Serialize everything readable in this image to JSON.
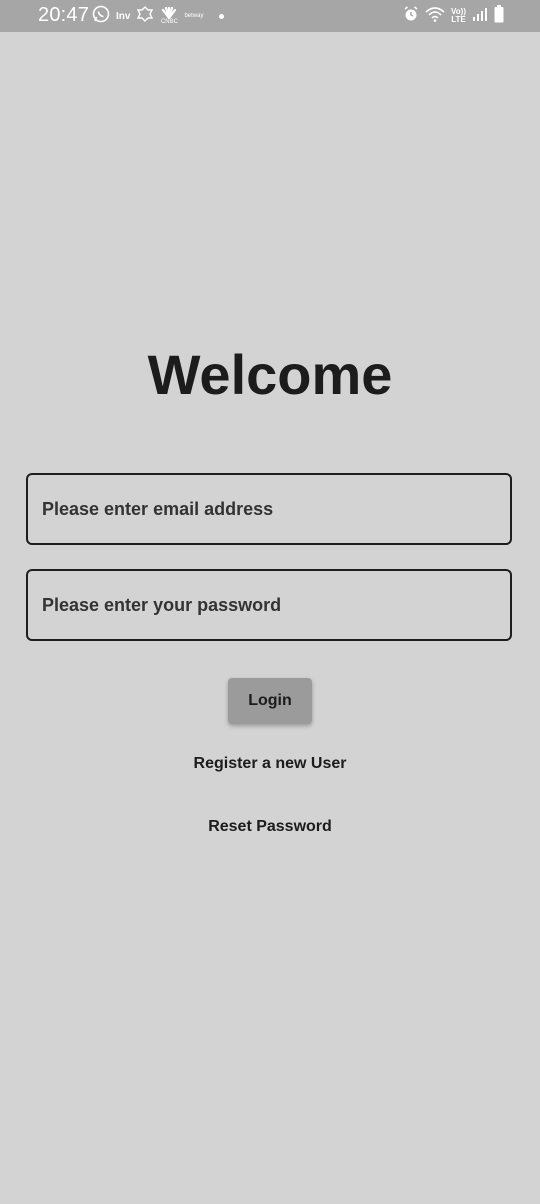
{
  "status_bar": {
    "time": "20:47",
    "left_icons": [
      "whatsapp-icon",
      "inv-app-icon",
      "notification-app-icon",
      "cnbc-icon",
      "betway-icon"
    ],
    "inv_text": "Inv",
    "cnbc_text": "CNBC",
    "betway_text": "betway",
    "volte_line1": "Vo))",
    "volte_line2": "LTE",
    "right_icons": [
      "alarm-icon",
      "wifi-icon",
      "volte-lte-icon",
      "signal-icon",
      "battery-icon"
    ]
  },
  "main": {
    "title": "Welcome",
    "email_placeholder": "Please enter email address",
    "email_value": "",
    "password_placeholder": "Please enter your password",
    "password_value": "",
    "login_label": "Login",
    "register_label": "Register a new User",
    "reset_label": "Reset Password"
  },
  "colors": {
    "background": "#d3d3d3",
    "status_bar": "#a6a6a6",
    "button": "#9b9b9b",
    "text": "#1c1c1c"
  }
}
